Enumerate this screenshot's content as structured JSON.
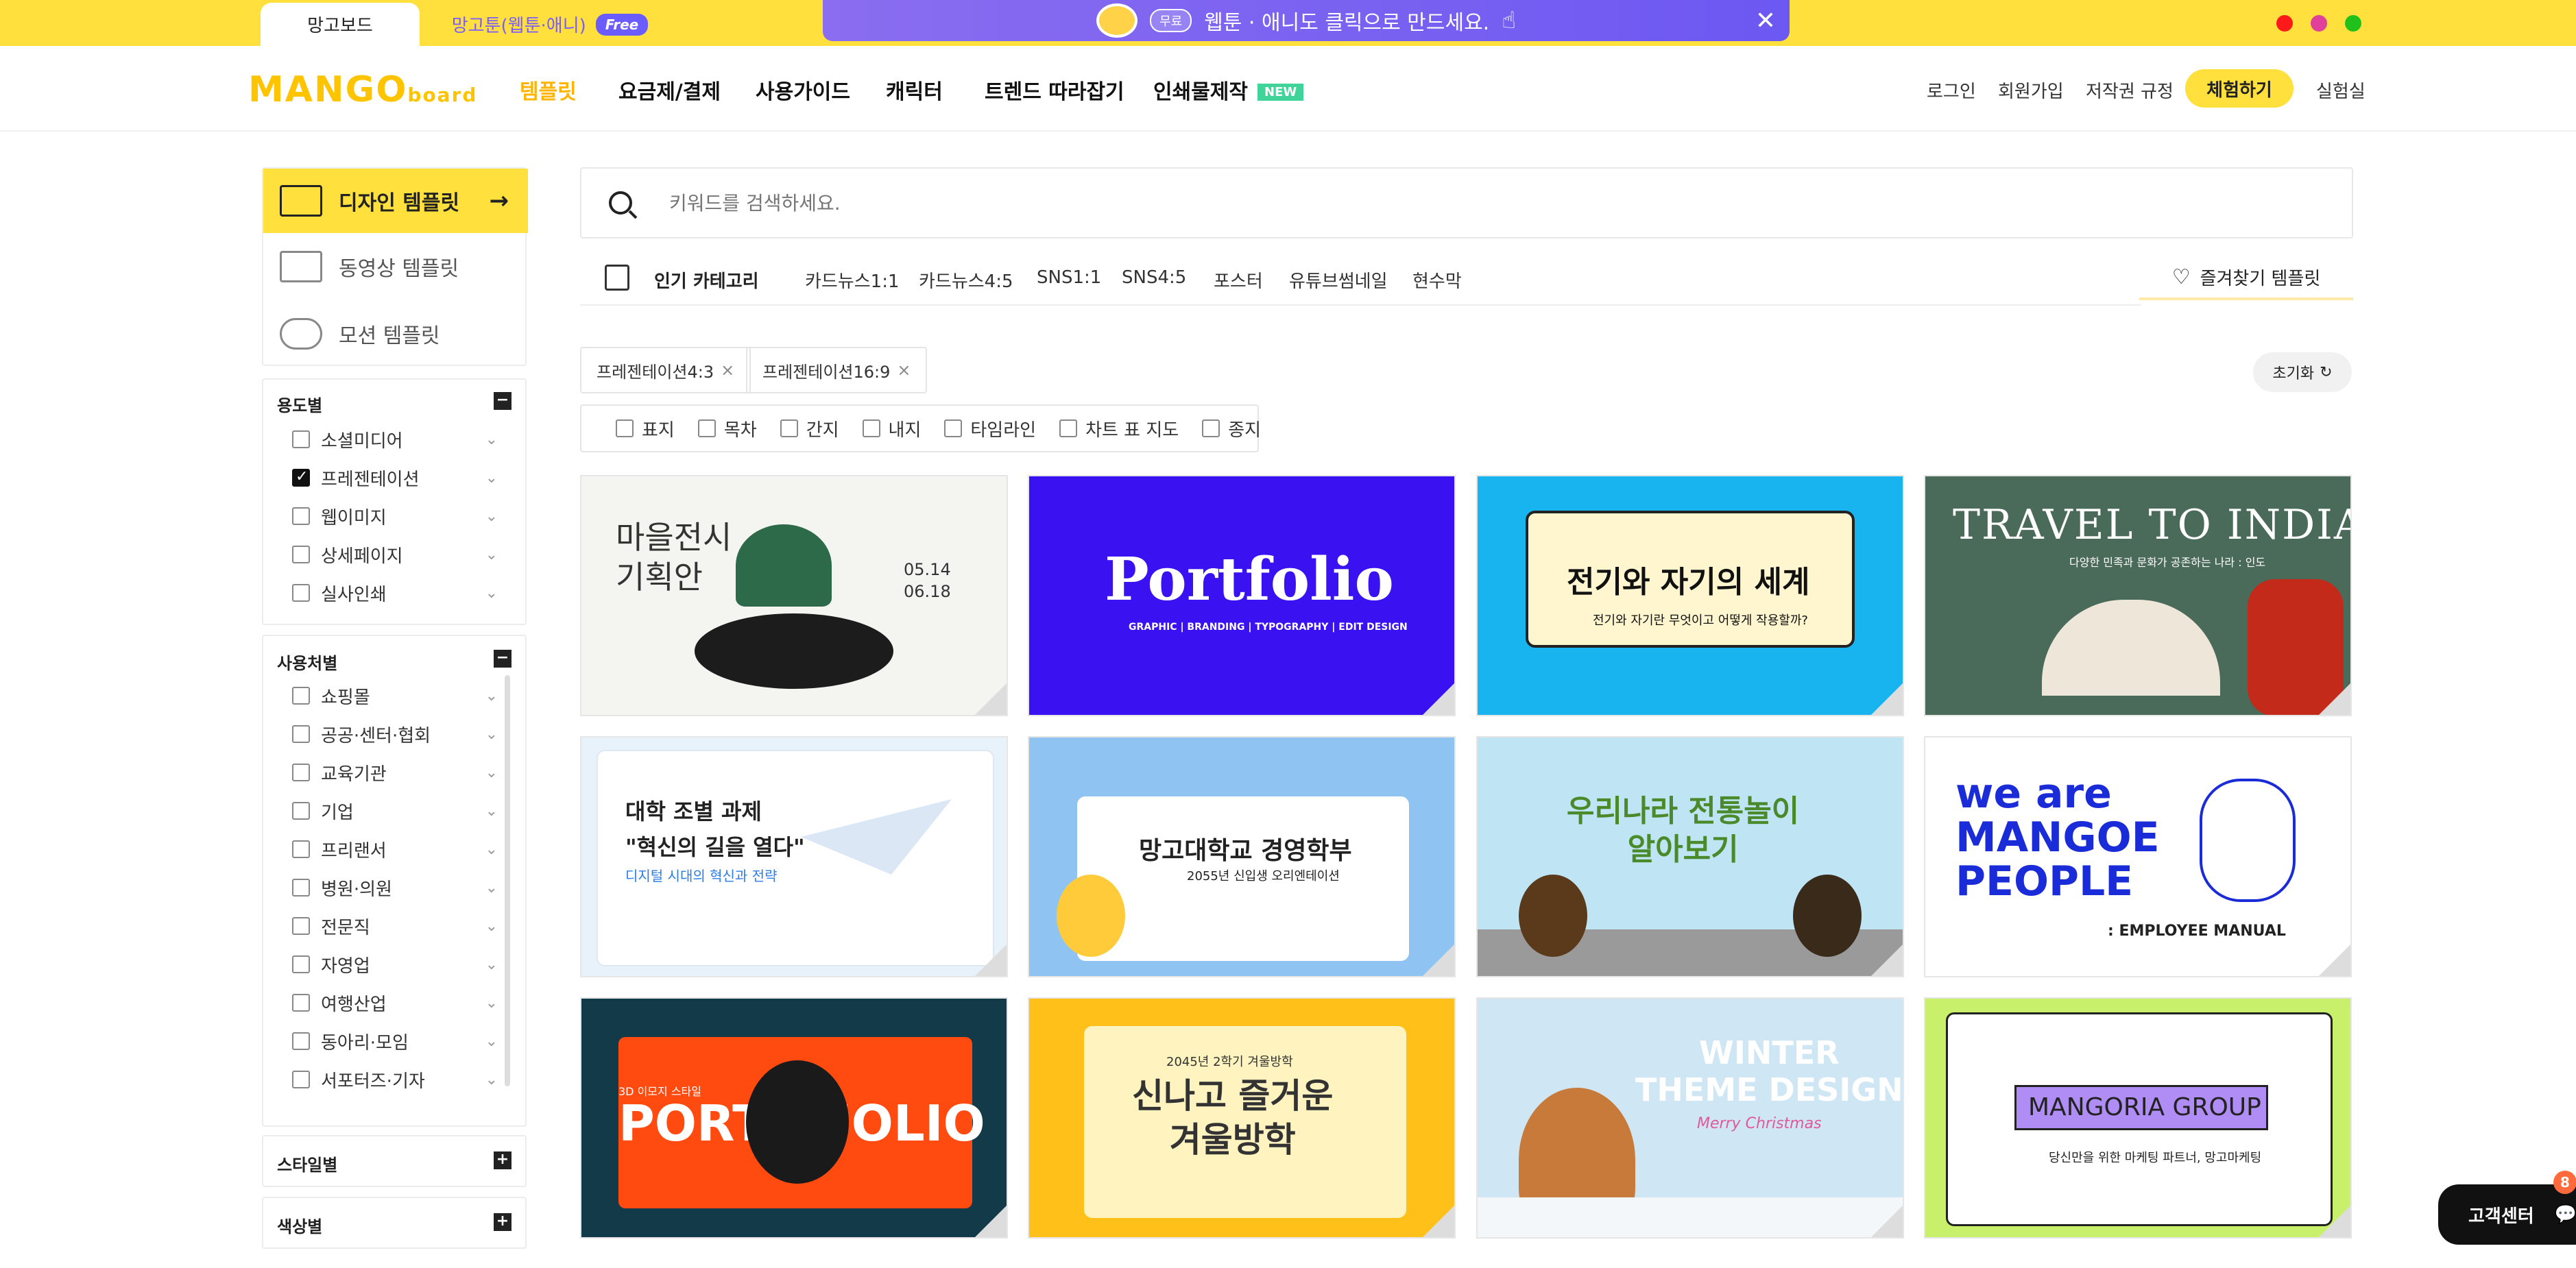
{
  "topbar": {
    "tab_mangoboard": "망고보드",
    "tab_mangotoon": "망고툰(웹툰·애니)",
    "free_badge": "Free",
    "promo_pill": "무료",
    "promo_text": "웹툰 · 애니도 클릭으로 만드세요.",
    "close": "✕"
  },
  "nav": {
    "logo": "MANGO",
    "logo_sub": "board",
    "items": [
      "템플릿",
      "요금제/결제",
      "사용가이드",
      "캐릭터",
      "트렌드 따라잡기",
      "인쇄물제작"
    ],
    "new_badge": "NEW",
    "login": "로그인",
    "signup": "회원가입",
    "copyright": "저작권 규정",
    "trial": "체험하기",
    "lab": "실험실"
  },
  "sidebar": {
    "templates": [
      {
        "label": "디자인 템플릿",
        "icon": "image-icon"
      },
      {
        "label": "동영상 템플릿",
        "icon": "play-icon"
      },
      {
        "label": "모션 템플릿",
        "icon": "motion-icon"
      }
    ],
    "arrow": "→",
    "purpose": {
      "title": "용도별",
      "toggle": "−",
      "items": [
        {
          "label": "소셜미디어",
          "checked": false
        },
        {
          "label": "프레젠테이션",
          "checked": true
        },
        {
          "label": "웹이미지",
          "checked": false
        },
        {
          "label": "상세페이지",
          "checked": false
        },
        {
          "label": "실사인쇄",
          "checked": false
        }
      ]
    },
    "user": {
      "title": "사용처별",
      "toggle": "−",
      "items": [
        "쇼핑몰",
        "공공·센터·협회",
        "교육기관",
        "기업",
        "프리랜서",
        "병원·의원",
        "전문직",
        "자영업",
        "여행산업",
        "동아리·모임",
        "서포터즈·기자"
      ]
    },
    "style": {
      "title": "스타일별",
      "toggle": "+"
    },
    "color": {
      "title": "색상별",
      "toggle": "+"
    }
  },
  "search": {
    "placeholder": "키워드를 검색하세요."
  },
  "popular": {
    "label": "인기 카테고리",
    "items": [
      "카드뉴스1:1",
      "카드뉴스4:5",
      "SNS1:1",
      "SNS4:5",
      "포스터",
      "유튜브썸네일",
      "현수막"
    ],
    "favorites": "즐겨찾기 템플릿"
  },
  "chips": [
    "프레젠테이션4:3",
    "프레젠테이션16:9"
  ],
  "chip_x": "×",
  "reset": "초기화",
  "subfilters": [
    "표지",
    "목차",
    "간지",
    "내지",
    "타임라인",
    "차트 표 지도",
    "종지"
  ],
  "cards": [
    {
      "title": "마을전시\n기획안",
      "sub": "05.14\n06.18",
      "bg": "#f4f5f0",
      "fg": "#333"
    },
    {
      "title": "Portfolio",
      "sub": "GRAPHIC | BRANDING | TYPOGRAPHY | EDIT DESIGN",
      "bg": "#3a12f2",
      "fg": "#ffffff"
    },
    {
      "title": "전기와 자기의 세계",
      "sub": "전기와 자기란 무엇이고 어떻게 작용할까?",
      "bg": "#18b4f0",
      "fg": "#111"
    },
    {
      "title": "TRAVEL TO INDIA",
      "sub": "다양한 민족과 문화가 공존하는 나라 : 인도",
      "bg": "#4a6a5a",
      "fg": "#ffffff"
    },
    {
      "title": "대학 조별 과제\n\"혁신의 길을 열다\"",
      "sub": "디지털 시대의 혁신과 전략",
      "bg": "#e8f2fb",
      "fg": "#222"
    },
    {
      "title": "망고대학교 경영학부",
      "sub": "2055년 신입생 오리엔테이션",
      "bg": "#8fc4f2",
      "fg": "#222"
    },
    {
      "title": "우리나라 전통놀이\n알아보기",
      "sub": "",
      "bg": "#bfe4f4",
      "fg": "#4a8a2a"
    },
    {
      "title": "we are\nMANGOE\nPEOPLE",
      "sub": ": EMPLOYEE MANUAL",
      "bg": "#ffffff",
      "fg": "#1a2bd8"
    },
    {
      "title": "PORT   FOLIO",
      "sub": "3D 이모지 스타일",
      "bg": "#ff4a10",
      "fg": "#ffffff"
    },
    {
      "title": "신나고 즐거운\n겨울방학",
      "sub": "2045년 2학기 겨울방학",
      "bg": "#ffc01a",
      "fg": "#333"
    },
    {
      "title": "WINTER\nTHEME DESIGN",
      "sub": "Merry Christmas",
      "bg": "#cfe6f5",
      "fg": "#ffffff"
    },
    {
      "title": "MANGORIA GROUP",
      "sub": "당신만을 위한 마케팅 파트너, 망고마케팅",
      "bg": "#c8f06a",
      "fg": "#222"
    }
  ],
  "help": {
    "label": "고객센터",
    "badge": "8"
  },
  "colors": {
    "accent": "#ffe03c",
    "brand": "#ffc400",
    "promo": "#6c58f2"
  }
}
